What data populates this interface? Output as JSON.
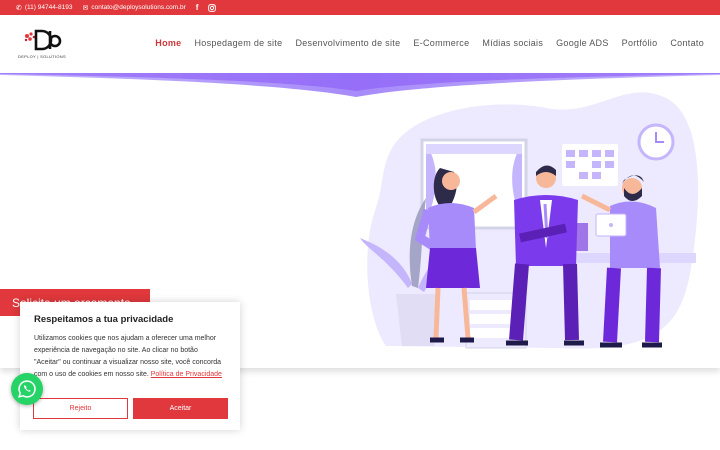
{
  "topbar": {
    "phone": "(11) 94744-8193",
    "email": "contato@deploysolutions.com.br",
    "icons": [
      "phone-icon",
      "mail-icon",
      "facebook-icon",
      "instagram-icon"
    ]
  },
  "logo": {
    "text": "DEPLOY | SOLUTIONS"
  },
  "nav": {
    "items": [
      {
        "label": "Home",
        "active": true
      },
      {
        "label": "Hospedagem de site"
      },
      {
        "label": "Desenvolvimento de site"
      },
      {
        "label": "E-Commerce"
      },
      {
        "label": "Mídias sociais"
      },
      {
        "label": "Google ADS"
      },
      {
        "label": "Portfólio"
      },
      {
        "label": "Contato"
      }
    ]
  },
  "hero": {
    "cta_label": "Solicite um orçamento"
  },
  "cookie": {
    "title": "Respeitamos a tua privacidade",
    "text": "Utilizamos cookies que nos ajudam a oferecer uma melhor experiência de navegação no site. Ao clicar no botão \"Aceitar\" ou continuar a visualizar nosso site, você concorda com o uso de cookies em nosso site.",
    "link": "Política de Privacidade",
    "reject": "Rejeito",
    "accept": "Aceitar"
  },
  "colors": {
    "brand": "#e0383c",
    "purple": "#8b5cf6",
    "whatsapp": "#25d366"
  }
}
